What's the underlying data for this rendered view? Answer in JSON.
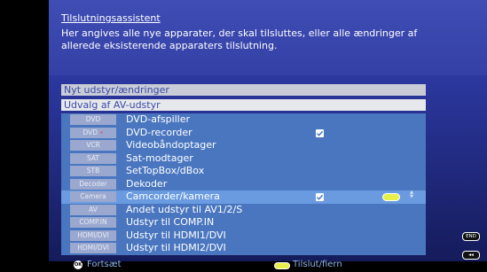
{
  "header": {
    "title": "Tilslutningsassistent",
    "description": "Her angives alle nye apparater, der skal tilsluttes, eller alle ændringer af allerede eksisterende apparaters tilslutning."
  },
  "bars": {
    "new_equipment": "Nyt udstyr/ændringer",
    "av_selection": "Udvalg af AV-udstyr"
  },
  "devices": [
    {
      "tag": "DVD",
      "tag_dot": "",
      "label": "DVD-afspiller",
      "checked": false,
      "selected": false
    },
    {
      "tag": "DVD",
      "tag_dot": "•",
      "label": "DVD-recorder",
      "checked": true,
      "selected": false
    },
    {
      "tag": "VCR",
      "tag_dot": "",
      "label": "Videobåndoptager",
      "checked": false,
      "selected": false
    },
    {
      "tag": "SAT",
      "tag_dot": "",
      "label": "Sat-modtager",
      "checked": false,
      "selected": false
    },
    {
      "tag": "STB",
      "tag_dot": "",
      "label": "SetTopBox/dBox",
      "checked": false,
      "selected": false
    },
    {
      "tag": "Decoder",
      "tag_dot": "",
      "label": "Dekoder",
      "checked": false,
      "selected": false
    },
    {
      "tag": "Camera",
      "tag_dot": "",
      "label": "Camcorder/kamera",
      "checked": true,
      "selected": true
    },
    {
      "tag": "AV",
      "tag_dot": "",
      "label": "Andet udstyr til AV1/2/S",
      "checked": false,
      "selected": false
    },
    {
      "tag": "COMP.IN",
      "tag_dot": "",
      "label": "Udstyr til COMP.IN",
      "checked": false,
      "selected": false
    },
    {
      "tag": "HDMI/DVI",
      "tag_dot": "",
      "label": "Udstyr til HDMI1/DVI",
      "checked": false,
      "selected": false
    },
    {
      "tag": "HDMI/DVI",
      "tag_dot": "",
      "label": "Udstyr til HDMI2/DVI",
      "checked": false,
      "selected": false
    }
  ],
  "side_buttons": {
    "end": "END",
    "back": "◂◂"
  },
  "footer": {
    "ok_icon": "OK",
    "continue_label": "Fortsæt",
    "connect_label": "Tilslut/fiern"
  },
  "colors": {
    "panel_blue": "#2c38a0",
    "row_blue": "#4a76c0",
    "selected_row": "#6a9be0",
    "yellow_button": "#e8ef4a"
  }
}
